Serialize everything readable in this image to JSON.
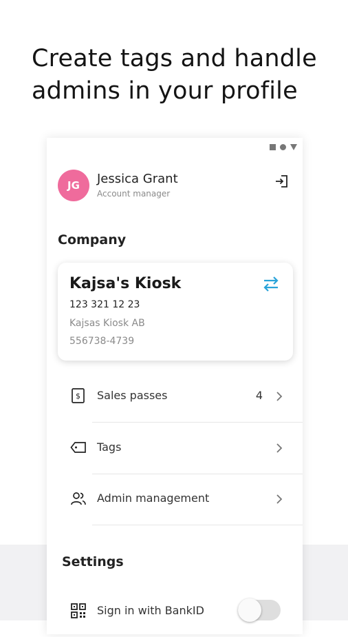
{
  "headline": "Create tags and handle admins in your profile",
  "profile": {
    "initials": "JG",
    "name": "Jessica Grant",
    "role": "Account manager"
  },
  "company": {
    "section_title": "Company",
    "name": "Kajsa's Kiosk",
    "phone": "123 321 12 23",
    "legal_name": "Kajsas Kiosk AB",
    "org_number": "556738-4739"
  },
  "menu": [
    {
      "label": "Sales passes",
      "count": "4",
      "icon": "sales-pass-icon"
    },
    {
      "label": "Tags",
      "count": "",
      "icon": "tag-icon"
    },
    {
      "label": "Admin management",
      "count": "",
      "icon": "admins-icon"
    }
  ],
  "settings": {
    "section_title": "Settings",
    "bankid_label": "Sign in with BankID"
  },
  "colors": {
    "avatar": "#ef6b9c",
    "accent": "#29a3d9",
    "background_band": "#f1f1f3"
  }
}
